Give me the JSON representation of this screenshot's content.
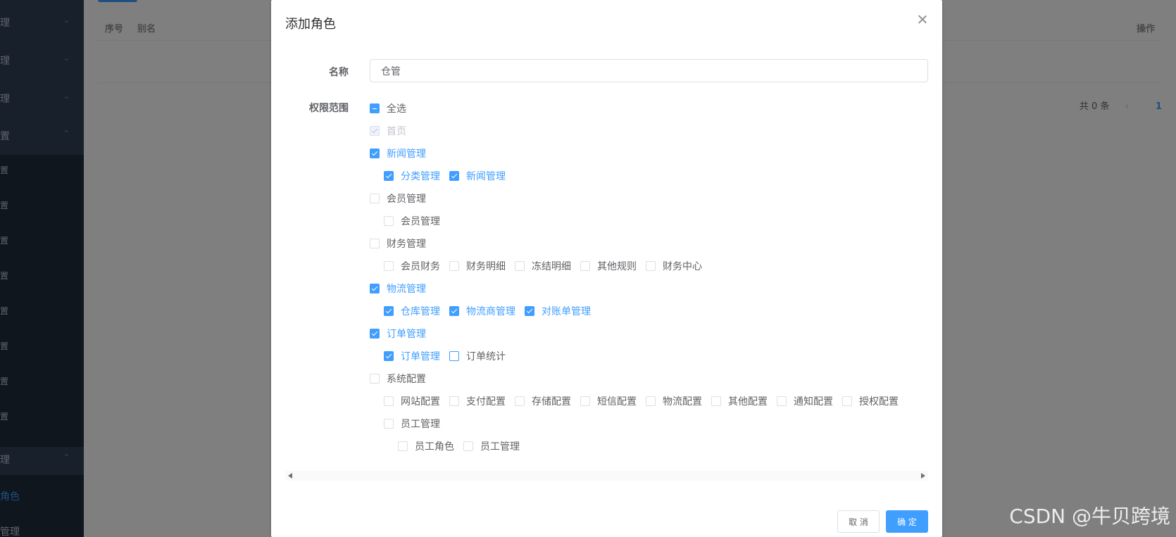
{
  "sidebar": {
    "items": [
      {
        "label": "理",
        "arrow": "⌄"
      },
      {
        "label": "理",
        "arrow": "⌄"
      },
      {
        "label": "理",
        "arrow": "⌄"
      },
      {
        "label": "置",
        "arrow": "⌃"
      },
      {
        "label": "置"
      },
      {
        "label": "置"
      },
      {
        "label": "置"
      },
      {
        "label": "置"
      },
      {
        "label": "置"
      },
      {
        "label": "置"
      },
      {
        "label": "置"
      },
      {
        "label": "置"
      },
      {
        "label": "理",
        "arrow": "⌃"
      },
      {
        "label": "角色"
      },
      {
        "label": "管理"
      }
    ]
  },
  "table": {
    "headers": [
      "序号",
      "别名",
      "操作"
    ]
  },
  "pagination": {
    "total": "共 0 条",
    "prev": "‹",
    "page": "1"
  },
  "dialog": {
    "title": "添加角色",
    "name_label": "名称",
    "name_value": "仓管",
    "scope_label": "权限范围",
    "select_all": "全选",
    "permissions": [
      {
        "label": "首页",
        "state": "disabled",
        "children": []
      },
      {
        "label": "新闻管理",
        "state": "checked",
        "children": [
          {
            "label": "分类管理",
            "state": "checked"
          },
          {
            "label": "新闻管理",
            "state": "checked"
          }
        ]
      },
      {
        "label": "会员管理",
        "state": "unchecked",
        "children": [
          {
            "label": "会员管理",
            "state": "unchecked"
          }
        ]
      },
      {
        "label": "财务管理",
        "state": "unchecked",
        "children": [
          {
            "label": "会员财务",
            "state": "unchecked"
          },
          {
            "label": "财务明细",
            "state": "unchecked"
          },
          {
            "label": "冻结明细",
            "state": "unchecked"
          },
          {
            "label": "其他规则",
            "state": "unchecked"
          },
          {
            "label": "财务中心",
            "state": "unchecked"
          }
        ]
      },
      {
        "label": "物流管理",
        "state": "checked",
        "children": [
          {
            "label": "仓库管理",
            "state": "checked"
          },
          {
            "label": "物流商管理",
            "state": "checked"
          },
          {
            "label": "对账单管理",
            "state": "checked"
          }
        ]
      },
      {
        "label": "订单管理",
        "state": "checked",
        "children": [
          {
            "label": "订单管理",
            "state": "checked"
          },
          {
            "label": "订单统计",
            "state": "focus"
          }
        ]
      },
      {
        "label": "系统配置",
        "state": "unchecked",
        "children": [
          {
            "label": "网站配置",
            "state": "unchecked"
          },
          {
            "label": "支付配置",
            "state": "unchecked"
          },
          {
            "label": "存储配置",
            "state": "unchecked"
          },
          {
            "label": "短信配置",
            "state": "unchecked"
          },
          {
            "label": "物流配置",
            "state": "unchecked"
          },
          {
            "label": "其他配置",
            "state": "unchecked"
          },
          {
            "label": "通知配置",
            "state": "unchecked"
          },
          {
            "label": "授权配置",
            "state": "unchecked"
          }
        ]
      }
    ],
    "staff": {
      "label": "员工管理",
      "children": [
        "员工角色",
        "员工管理"
      ]
    },
    "cancel_label": "取 消",
    "ok_label": "确 定"
  },
  "watermark": "CSDN @牛贝跨境",
  "colors": {
    "primary": "#409eff",
    "sidebar": "#304156",
    "overlay": "rgba(0,0,0,0.5)"
  }
}
